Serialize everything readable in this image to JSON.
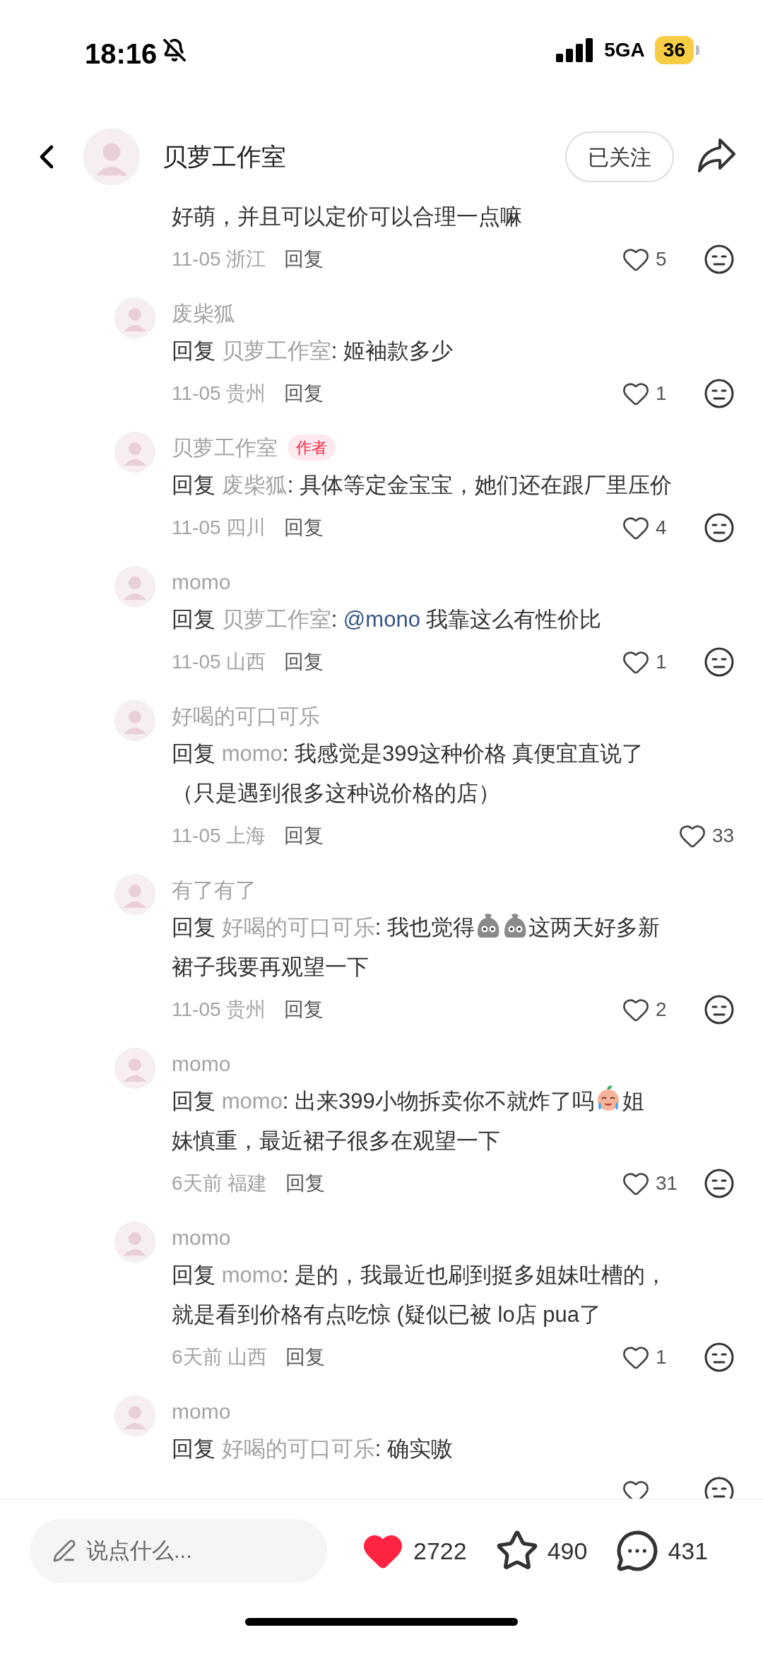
{
  "status_bar": {
    "time": "18:16",
    "network": "5GA",
    "battery": "36"
  },
  "header": {
    "title": "贝萝工作室",
    "follow_button": "已关注"
  },
  "comments": [
    {
      "kind": "continued",
      "lines": [
        [
          {
            "kind": "text",
            "text": "好萌，并且可以定价可以合理一点嘛"
          }
        ]
      ],
      "meta": "11-05 浙江",
      "reply": "回复",
      "likes": "5",
      "dislike_icon": true
    },
    {
      "kind": "reply",
      "user": "废柴狐",
      "prefix": "回复",
      "target": "贝萝工作室",
      "lines": [
        [
          {
            "kind": "text",
            "text": ": 姬袖款多少"
          }
        ]
      ],
      "meta": "11-05 贵州",
      "reply": "回复",
      "likes": "1",
      "dislike_icon": true
    },
    {
      "kind": "reply",
      "user": "贝萝工作室",
      "badge": "作者",
      "prefix": "回复",
      "target": "废柴狐",
      "lines": [
        [
          {
            "kind": "text",
            "text": ": 具体等定金宝宝，她们还在跟厂里压价"
          }
        ]
      ],
      "meta": "11-05 四川",
      "reply": "回复",
      "likes": "4",
      "dislike_icon": true
    },
    {
      "kind": "reply",
      "user": "momo",
      "prefix": "回复",
      "target": "贝萝工作室",
      "lines": [
        [
          {
            "kind": "text",
            "text": ": "
          },
          {
            "kind": "mention",
            "text": "@mono"
          },
          {
            "kind": "text",
            "text": " 我靠这么有性价比"
          }
        ]
      ],
      "meta": "11-05 山西",
      "reply": "回复",
      "likes": "1",
      "dislike_icon": true
    },
    {
      "kind": "reply",
      "user": "好喝的可口可乐",
      "prefix": "回复",
      "target": "momo",
      "lines": [
        [
          {
            "kind": "text",
            "text": ": 我感觉是399这种价格 真便宜直说了"
          }
        ],
        [
          {
            "kind": "text",
            "text": "（只是遇到很多这种说价格的店）"
          }
        ]
      ],
      "meta": "11-05 上海",
      "reply": "回复",
      "likes": "33",
      "dislike_icon": false
    },
    {
      "kind": "reply",
      "user": "有了有了",
      "prefix": "回复",
      "target": "好喝的可口可乐",
      "lines": [
        [
          {
            "kind": "text",
            "text": ": 我也觉得"
          },
          {
            "kind": "stone"
          },
          {
            "kind": "stone"
          },
          {
            "kind": "text",
            "text": "这两天好多新"
          }
        ],
        [
          {
            "kind": "text",
            "text": "裙子我要再观望一下"
          }
        ]
      ],
      "meta": "11-05 贵州",
      "reply": "回复",
      "likes": "2",
      "dislike_icon": true
    },
    {
      "kind": "reply",
      "user": "momo",
      "prefix": "回复",
      "target": "momo",
      "lines": [
        [
          {
            "kind": "text",
            "text": ": 出来399小物拆卖你不就炸了吗"
          },
          {
            "kind": "crying"
          },
          {
            "kind": "text",
            "text": "姐"
          }
        ],
        [
          {
            "kind": "text",
            "text": "妹慎重，最近裙子很多在观望一下"
          }
        ]
      ],
      "meta": "6天前 福建",
      "reply": "回复",
      "likes": "31",
      "dislike_icon": true
    },
    {
      "kind": "reply",
      "user": "momo",
      "prefix": "回复",
      "target": "momo",
      "lines": [
        [
          {
            "kind": "text",
            "text": ": 是的，我最近也刷到挺多姐妹吐槽的，"
          }
        ],
        [
          {
            "kind": "text",
            "text": "就是看到价格有点吃惊 (疑似已被 lo店 pua了"
          }
        ]
      ],
      "meta": "6天前 山西",
      "reply": "回复",
      "likes": "1",
      "dislike_icon": true
    },
    {
      "kind": "reply",
      "user": "momo",
      "prefix": "回复",
      "target": "好喝的可口可乐",
      "lines": [
        [
          {
            "kind": "text",
            "text": ": 确实嗷"
          }
        ]
      ],
      "dislike_icon": true
    }
  ],
  "bottom_bar": {
    "placeholder": "说点什么...",
    "likes": "2722",
    "liked": true,
    "favorites": "490",
    "comments": "431"
  }
}
